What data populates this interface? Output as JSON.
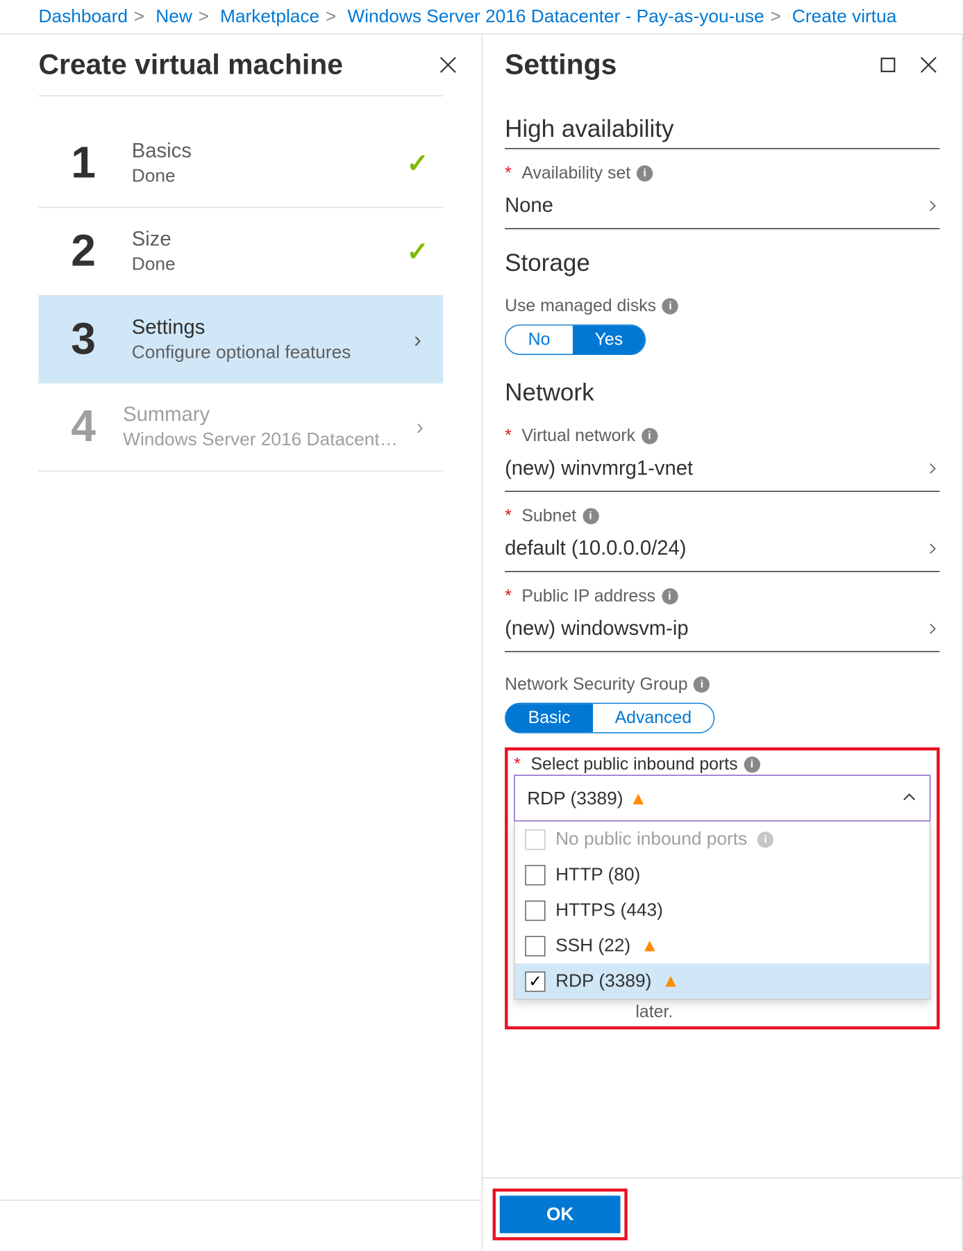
{
  "breadcrumb": [
    "Dashboard",
    "New",
    "Marketplace",
    "Windows Server 2016 Datacenter - Pay-as-you-use",
    "Create virtua"
  ],
  "left": {
    "title": "Create virtual machine",
    "steps": [
      {
        "num": "1",
        "title": "Basics",
        "sub": "Done",
        "state": "done"
      },
      {
        "num": "2",
        "title": "Size",
        "sub": "Done",
        "state": "done"
      },
      {
        "num": "3",
        "title": "Settings",
        "sub": "Configure optional features",
        "state": "active"
      },
      {
        "num": "4",
        "title": "Summary",
        "sub": "Windows Server 2016 Datacenter ...",
        "state": "disabled"
      }
    ]
  },
  "right": {
    "title": "Settings",
    "sections": {
      "ha": {
        "heading": "High availability",
        "availset_label": "Availability set",
        "availset_value": "None"
      },
      "storage": {
        "heading": "Storage",
        "managed_label": "Use managed disks",
        "no": "No",
        "yes": "Yes"
      },
      "network": {
        "heading": "Network",
        "vnet_label": "Virtual network",
        "vnet_value": "(new) winvmrg1-vnet",
        "subnet_label": "Subnet",
        "subnet_value": "default (10.0.0.0/24)",
        "pip_label": "Public IP address",
        "pip_value": "(new) windowsvm-ip",
        "nsg_label": "Network Security Group",
        "nsg_basic": "Basic",
        "nsg_adv": "Advanced",
        "ports_label": "Select public inbound ports",
        "ports_selected": "RDP (3389)",
        "ports_options": [
          {
            "label": "No public inbound ports",
            "disabled": true,
            "warn": false,
            "info": true,
            "checked": false
          },
          {
            "label": "HTTP (80)",
            "disabled": false,
            "warn": false,
            "info": false,
            "checked": false
          },
          {
            "label": "HTTPS (443)",
            "disabled": false,
            "warn": false,
            "info": false,
            "checked": false
          },
          {
            "label": "SSH (22)",
            "disabled": false,
            "warn": true,
            "info": false,
            "checked": false
          },
          {
            "label": "RDP (3389)",
            "disabled": false,
            "warn": true,
            "info": false,
            "checked": true
          }
        ],
        "later_text": "later."
      }
    },
    "ok": "OK"
  }
}
